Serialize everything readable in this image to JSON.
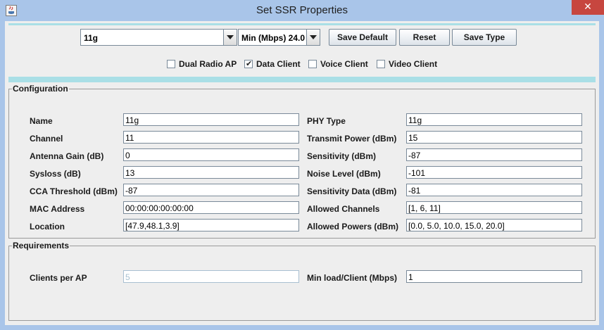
{
  "window": {
    "title": "Set SSR Properties",
    "close_glyph": "✕"
  },
  "toolbar": {
    "ssr_select": "11g",
    "rate_select": "Min (Mbps) 24.0",
    "save_default_label": "Save Default",
    "reset_label": "Reset",
    "save_type_label": "Save Type"
  },
  "client_types": [
    {
      "label": "Dual Radio AP",
      "checked": false
    },
    {
      "label": "Data Client",
      "checked": true
    },
    {
      "label": "Voice Client",
      "checked": false
    },
    {
      "label": "Video Client",
      "checked": false
    }
  ],
  "configuration": {
    "legend": "Configuration",
    "left": [
      {
        "label": "Name",
        "value": "11g"
      },
      {
        "label": "Channel",
        "value": "11"
      },
      {
        "label": "Antenna Gain (dB)",
        "value": "0"
      },
      {
        "label": "Sysloss (dB)",
        "value": "13"
      },
      {
        "label": "CCA Threshold (dBm)",
        "value": "-87"
      },
      {
        "label": "MAC Address",
        "value": "00:00:00:00:00:00"
      },
      {
        "label": "Location",
        "value": "[47.9,48.1,3.9]"
      }
    ],
    "right": [
      {
        "label": "PHY Type",
        "value": "11g"
      },
      {
        "label": "Transmit Power (dBm)",
        "value": "15"
      },
      {
        "label": "Sensitivity (dBm)",
        "value": "-87"
      },
      {
        "label": "Noise Level (dBm)",
        "value": "-101"
      },
      {
        "label": "Sensitivity Data (dBm)",
        "value": "-81"
      },
      {
        "label": "Allowed Channels",
        "value": "[1, 6, 11]"
      },
      {
        "label": "Allowed Powers (dBm)",
        "value": "[0.0, 5.0, 10.0, 15.0, 20.0]"
      }
    ]
  },
  "requirements": {
    "legend": "Requirements",
    "clients_label": "Clients per AP",
    "clients_value": "5",
    "minload_label": "Min load/Client (Mbps)",
    "minload_value": "1"
  },
  "colors": {
    "title_bar": "#a9c5e9",
    "close_button": "#c7463f",
    "stripe": "#a9dfe6",
    "panel": "#eeeeee"
  },
  "icons": {
    "app": "java-app-icon",
    "close": "close-icon",
    "dropdown": "chevron-down-icon",
    "checkbox": "checkmark-icon"
  }
}
